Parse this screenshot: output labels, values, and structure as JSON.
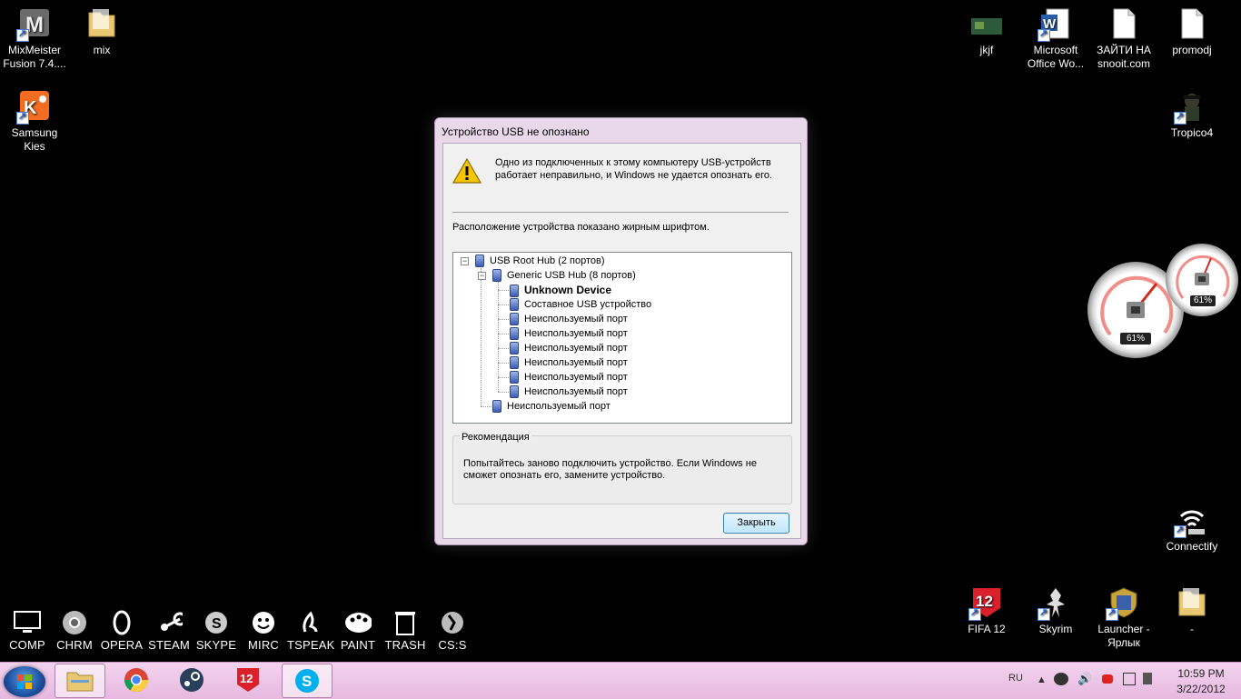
{
  "desktop": {
    "icons_left": [
      {
        "label": "MixMeister Fusion 7.4....",
        "icon": "mixmeister-icon"
      },
      {
        "label": "mix",
        "icon": "folder-icon"
      },
      {
        "label": "Samsung Kies",
        "icon": "samsung-kies-icon"
      }
    ],
    "icons_right": [
      {
        "label": "jkjf",
        "icon": "image-thumbnail-icon"
      },
      {
        "label": "Microsoft Office Wo...",
        "icon": "word-document-icon"
      },
      {
        "label": "ЗАЙТИ НА snooit.com",
        "icon": "text-file-icon"
      },
      {
        "label": "promodj",
        "icon": "text-file-icon"
      },
      {
        "label": "Tropico4",
        "icon": "tropico-icon"
      },
      {
        "label": "Connectify",
        "icon": "wifi-hotspot-icon"
      },
      {
        "label": "FIFA 12",
        "icon": "fifa-icon"
      },
      {
        "label": "Skyrim",
        "icon": "skyrim-icon"
      },
      {
        "label": "Launcher - Ярлык",
        "icon": "launcher-icon"
      },
      {
        "label": "-",
        "icon": "folder-icon"
      }
    ],
    "dock": [
      {
        "label": "COMP",
        "icon": "monitor-icon"
      },
      {
        "label": "CHRM",
        "icon": "chrome-icon"
      },
      {
        "label": "OPERA",
        "icon": "opera-icon"
      },
      {
        "label": "STEAM",
        "icon": "steam-icon"
      },
      {
        "label": "SKYPE",
        "icon": "skype-icon"
      },
      {
        "label": "MIRC",
        "icon": "mirc-icon"
      },
      {
        "label": "TSPEAK",
        "icon": "teamspeak-icon"
      },
      {
        "label": "PAINT",
        "icon": "palette-icon"
      },
      {
        "label": "TRASH",
        "icon": "trash-icon"
      },
      {
        "label": "CS:S",
        "icon": "counter-strike-icon"
      }
    ]
  },
  "gadgets": {
    "cpu_meter_large": "61%",
    "cpu_meter_small": "61%"
  },
  "dialog": {
    "title": "Устройство USB не опознано",
    "message": "Одно из подключенных к этому компьютеру USB-устройств работает неправильно, и Windows не удается опознать его.",
    "location_caption": "Расположение устройства показано жирным шрифтом.",
    "tree": [
      "USB Root Hub (2 портов)",
      "Generic USB Hub (8 портов)",
      "Unknown Device",
      "Составное USB устройство",
      "Неиспользуемый порт",
      "Неиспользуемый порт",
      "Неиспользуемый порт",
      "Неиспользуемый порт",
      "Неиспользуемый порт",
      "Неиспользуемый порт",
      "Неиспользуемый порт"
    ],
    "recommendation_title": "Рекомендация",
    "recommendation_text": "Попытайтесь заново подключить устройство. Если Windows не сможет опознать его, замените устройство.",
    "close_label": "Закрыть"
  },
  "taskbar": {
    "buttons": [
      "explorer-icon",
      "chrome-icon",
      "steam-icon",
      "fifa-icon",
      "skype-icon"
    ],
    "language": "RU",
    "time": "10:59 PM",
    "date": "3/22/2012"
  },
  "colors": {
    "taskbar": "#eac0e4",
    "dialog_frame": "#e8d8ea",
    "desktop": "#000000"
  }
}
